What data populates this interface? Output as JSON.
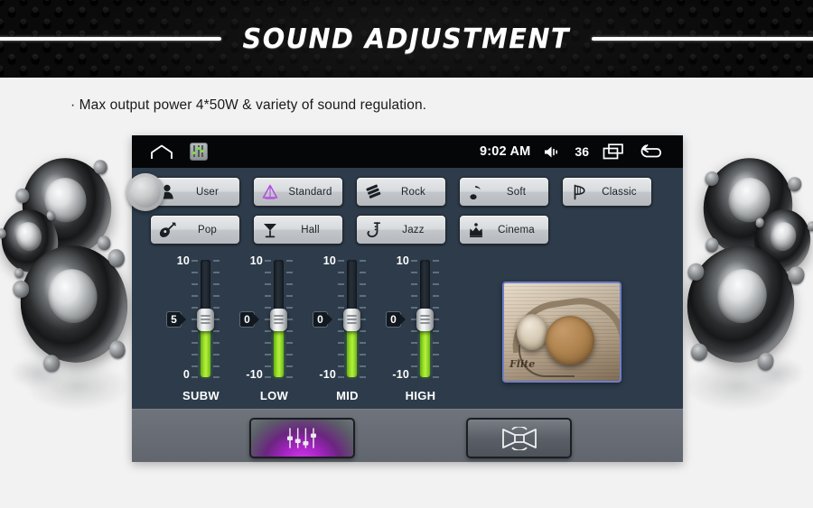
{
  "header": {
    "title": "SOUND ADJUSTMENT",
    "bg_color": "#0a0a0a",
    "title_color": "#ffffff"
  },
  "caption": {
    "text": "· Max output power 4*50W & variety of sound regulation."
  },
  "device": {
    "panel_color": "#2d3b4a",
    "statusbar": {
      "bg_color": "#050608",
      "home_icon": "home-icon",
      "app_icon": "equalizer-app-icon",
      "time": "9:02 AM",
      "volume_icon": "speaker-volume-icon",
      "volume_value": "36",
      "recents_icon": "recents-icon",
      "back_icon": "back-arrow-icon"
    },
    "knob": {
      "name": "rotary-knob"
    },
    "presets": {
      "row1": [
        {
          "label": "User",
          "icon": "person-icon",
          "selected": false
        },
        {
          "label": "Standard",
          "icon": "pyramid-icon",
          "selected": false
        },
        {
          "label": "Rock",
          "icon": "stack-icon",
          "selected": false
        },
        {
          "label": "Soft",
          "icon": "music-note-icon",
          "selected": false
        },
        {
          "label": "Classic",
          "icon": "harp-icon",
          "selected": false
        }
      ],
      "row2": [
        {
          "label": "Pop",
          "icon": "guitar-icon",
          "selected": false
        },
        {
          "label": "Hall",
          "icon": "cocktail-glass-icon",
          "selected": false
        },
        {
          "label": "Jazz",
          "icon": "saxophone-icon",
          "selected": false
        },
        {
          "label": "Cinema",
          "icon": "crown-icon",
          "selected": false
        }
      ]
    },
    "sliders": [
      {
        "label": "SUBW",
        "value": "5",
        "max_label": "10",
        "min_label": "0",
        "min": 0,
        "max": 10,
        "value_num": 5
      },
      {
        "label": "LOW",
        "value": "0",
        "max_label": "10",
        "min_label": "-10",
        "min": -10,
        "max": 10,
        "value_num": 0
      },
      {
        "label": "MID",
        "value": "0",
        "max_label": "10",
        "min_label": "-10",
        "min": -10,
        "max": 10,
        "value_num": 0
      },
      {
        "label": "HIGH",
        "value": "0",
        "max_label": "10",
        "min_label": "-10",
        "min": -10,
        "max": 10,
        "value_num": 0
      }
    ],
    "album_art": {
      "name": "headphones-photo",
      "caption_text": "Flite",
      "border_color": "#6f7ec9"
    },
    "bottom_bar": {
      "bg_color": "#61666e",
      "buttons": [
        {
          "name": "equalizer-tab-button",
          "icon": "equalizer-sliders-icon",
          "active": true,
          "accent": "#c32ee0"
        },
        {
          "name": "balance-tab-button",
          "icon": "balance-fader-icon",
          "active": false,
          "accent": "#ffffff"
        }
      ]
    }
  },
  "decor": {
    "left_speakers": "speaker-cone-cluster-left",
    "right_speakers": "speaker-cone-cluster-right"
  }
}
